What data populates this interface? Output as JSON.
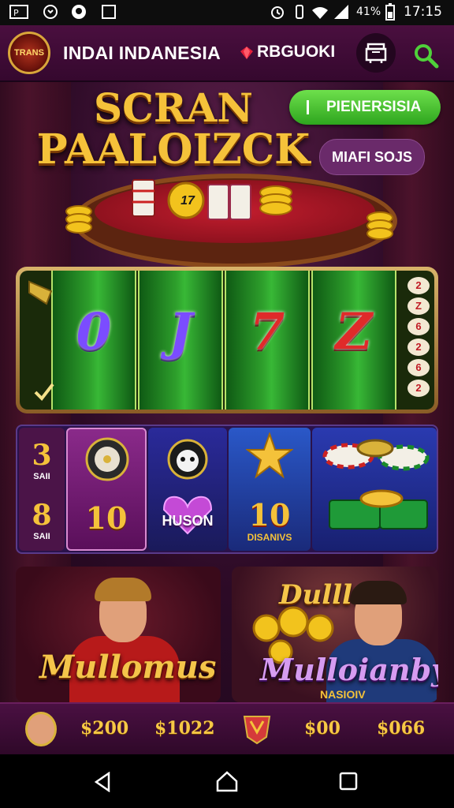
{
  "status_bar": {
    "left_icons": [
      "notification-icon",
      "whatsapp-icon",
      "messenger-icon",
      "square-notification-icon"
    ],
    "battery": "41%",
    "time": "17:15"
  },
  "header": {
    "logo_text": "TRANS",
    "title": "INDAI INDANESIA",
    "register_label": "RBGUOKI"
  },
  "hero": {
    "title_line1": "SCRAN",
    "title_line2": "PAALOIZCK",
    "green_button": "PIENERSISIA",
    "purple_button": "MIAFI SOJS",
    "table_chip_number": "17"
  },
  "slot": {
    "symbols": [
      "0",
      "J",
      "7",
      "Z"
    ],
    "side_numbers": [
      "2",
      "Z",
      "6",
      "2",
      "6",
      "2"
    ]
  },
  "tiles": {
    "counter_top": "3",
    "counter_top_sub": "SAII",
    "counter_bottom": "8",
    "counter_bottom_sub": "SAII",
    "tile1_bottom": "10",
    "tile2_bottom": "HUSON",
    "tile3_bottom": "10",
    "tile3_sub": "DISANIVS"
  },
  "promos": [
    {
      "name": "Mullomus"
    },
    {
      "name": "Mulloianby",
      "top_text": "Dulllus",
      "sub": "NASIOIV"
    }
  ],
  "bottom_bar": {
    "amount1": "$200",
    "amount2": "$1022",
    "amount3": "$00",
    "amount4": "$066"
  },
  "colors": {
    "brand_purple": "#4a0f3f",
    "accent_gold": "#f5c23a",
    "accent_green": "#3fc02c"
  }
}
